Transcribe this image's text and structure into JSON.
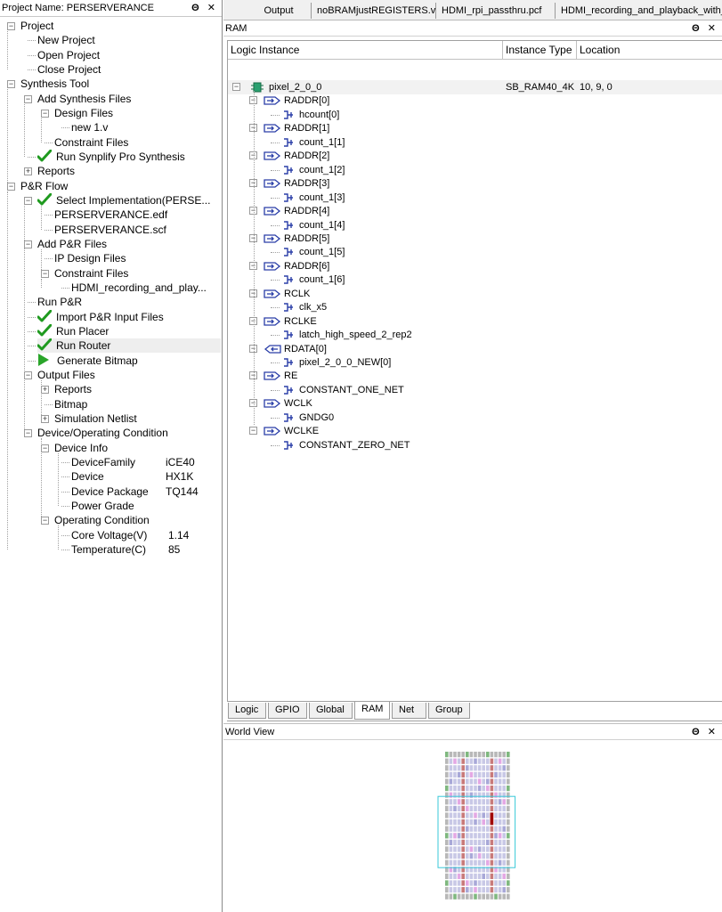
{
  "project_panel": {
    "title": "Project Name: PERSERVERANCE",
    "controls": "Θ ✕",
    "items": [
      {
        "label": "Project",
        "depth": 0,
        "expander": "minus",
        "icon": ""
      },
      {
        "label": "New Project",
        "depth": 1,
        "expander": "",
        "icon": ""
      },
      {
        "label": "Open Project",
        "depth": 1,
        "expander": "",
        "icon": ""
      },
      {
        "label": "Close Project",
        "depth": 1,
        "expander": "",
        "icon": ""
      },
      {
        "label": "Synthesis Tool",
        "depth": 0,
        "expander": "minus",
        "icon": ""
      },
      {
        "label": "Add Synthesis Files",
        "depth": 1,
        "expander": "minus",
        "icon": ""
      },
      {
        "label": "Design Files",
        "depth": 2,
        "expander": "minus",
        "icon": ""
      },
      {
        "label": "new 1.v",
        "depth": 3,
        "expander": "",
        "icon": ""
      },
      {
        "label": "Constraint Files",
        "depth": 2,
        "expander": "",
        "icon": ""
      },
      {
        "label": "Run Synplify Pro Synthesis",
        "depth": 1,
        "expander": "",
        "icon": "check"
      },
      {
        "label": "Reports",
        "depth": 1,
        "expander": "plus",
        "icon": ""
      },
      {
        "label": "P&R Flow",
        "depth": 0,
        "expander": "minus",
        "icon": ""
      },
      {
        "label": "Select Implementation(PERSE...",
        "depth": 1,
        "expander": "minus",
        "icon": "check"
      },
      {
        "label": "PERSERVERANCE.edf",
        "depth": 2,
        "expander": "",
        "icon": ""
      },
      {
        "label": "PERSERVERANCE.scf",
        "depth": 2,
        "expander": "",
        "icon": ""
      },
      {
        "label": "Add P&R Files",
        "depth": 1,
        "expander": "minus",
        "icon": ""
      },
      {
        "label": "IP Design Files",
        "depth": 2,
        "expander": "",
        "icon": ""
      },
      {
        "label": "Constraint Files",
        "depth": 2,
        "expander": "minus",
        "icon": ""
      },
      {
        "label": "HDMI_recording_and_play...",
        "depth": 3,
        "expander": "",
        "icon": ""
      },
      {
        "label": "Run P&R",
        "depth": 1,
        "expander": "",
        "icon": ""
      },
      {
        "label": "Import P&R Input Files",
        "depth": 1,
        "expander": "",
        "icon": "check"
      },
      {
        "label": "Run Placer",
        "depth": 1,
        "expander": "",
        "icon": "check"
      },
      {
        "label": "Run Router",
        "depth": 1,
        "expander": "",
        "icon": "check",
        "selected": true
      },
      {
        "label": "Generate Bitmap",
        "depth": 1,
        "expander": "",
        "icon": "play"
      },
      {
        "label": "Output Files",
        "depth": 1,
        "expander": "minus",
        "icon": ""
      },
      {
        "label": "Reports",
        "depth": 2,
        "expander": "plus",
        "icon": ""
      },
      {
        "label": "Bitmap",
        "depth": 2,
        "expander": "",
        "icon": ""
      },
      {
        "label": "Simulation Netlist",
        "depth": 2,
        "expander": "plus",
        "icon": ""
      },
      {
        "label": "Device/Operating Condition",
        "depth": 1,
        "expander": "minus",
        "icon": ""
      },
      {
        "label": "Device Info",
        "depth": 2,
        "expander": "minus",
        "icon": ""
      },
      {
        "label": "DeviceFamily",
        "depth": 3,
        "expander": "",
        "icon": "",
        "value": "iCE40"
      },
      {
        "label": "Device",
        "depth": 3,
        "expander": "",
        "icon": "",
        "value": "HX1K"
      },
      {
        "label": "Device Package",
        "depth": 3,
        "expander": "",
        "icon": "",
        "value": "TQ144"
      },
      {
        "label": "Power Grade",
        "depth": 3,
        "expander": "",
        "icon": "",
        "value": ""
      },
      {
        "label": "Operating Condition",
        "depth": 2,
        "expander": "minus",
        "icon": ""
      },
      {
        "label": "Core Voltage(V)",
        "depth": 3,
        "expander": "",
        "icon": "",
        "value": "1.14"
      },
      {
        "label": "Temperature(C)",
        "depth": 3,
        "expander": "",
        "icon": "",
        "value": "85"
      }
    ]
  },
  "top_tabs": [
    "Output",
    "noBRAMjustREGISTERS.v",
    "HDMI_rpi_passthru.pcf",
    "HDMI_recording_and_playback_with_S"
  ],
  "ram_panel": {
    "title": "RAM",
    "controls": "Θ ✕",
    "columns": [
      "Logic Instance",
      "Instance Type",
      "Location"
    ],
    "root": {
      "label": "pixel_2_0_0",
      "type": "SB_RAM40_4K",
      "location": "10,  9,  0"
    },
    "ports": [
      {
        "name": "RADDR[0]",
        "dir": "in",
        "net": "hcount[0]"
      },
      {
        "name": "RADDR[1]",
        "dir": "in",
        "net": "count_1[1]"
      },
      {
        "name": "RADDR[2]",
        "dir": "in",
        "net": "count_1[2]"
      },
      {
        "name": "RADDR[3]",
        "dir": "in",
        "net": "count_1[3]"
      },
      {
        "name": "RADDR[4]",
        "dir": "in",
        "net": "count_1[4]"
      },
      {
        "name": "RADDR[5]",
        "dir": "in",
        "net": "count_1[5]"
      },
      {
        "name": "RADDR[6]",
        "dir": "in",
        "net": "count_1[6]"
      },
      {
        "name": "RCLK",
        "dir": "in",
        "net": "clk_x5"
      },
      {
        "name": "RCLKE",
        "dir": "in",
        "net": "latch_high_speed_2_rep2"
      },
      {
        "name": "RDATA[0]",
        "dir": "out",
        "net": "pixel_2_0_0_NEW[0]"
      },
      {
        "name": "RE",
        "dir": "in",
        "net": "CONSTANT_ONE_NET"
      },
      {
        "name": "WCLK",
        "dir": "in",
        "net": "GNDG0"
      },
      {
        "name": "WCLKE",
        "dir": "in",
        "net": "CONSTANT_ZERO_NET"
      }
    ]
  },
  "view_tabs": [
    {
      "label": "Logic",
      "active": false
    },
    {
      "label": "GPIO",
      "active": false
    },
    {
      "label": "Global",
      "active": false
    },
    {
      "label": "RAM",
      "active": true
    },
    {
      "label": "Net",
      "active": false
    },
    {
      "label": "Group",
      "active": false
    }
  ],
  "world_view": {
    "title": "World View",
    "controls": "Θ ✕",
    "colors": {
      "logic": "#c8c8e6",
      "ram": "#c87a7a",
      "io": "#b8b8b8",
      "io_green": "#7fb87f",
      "selected": "#a00000",
      "viewport": "#39c8d8"
    }
  }
}
